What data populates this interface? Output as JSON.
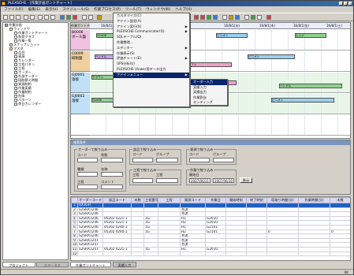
{
  "window": {
    "title": "PLEXSCHE - [作業計画ガントチャート]"
  },
  "menubar": [
    "ファイル(F)",
    "編集(E)",
    "表示(V)",
    "スケジュール(S)",
    "作業プロセス(P)",
    "ツール(T)",
    "ウィンドウ(W)",
    "ヘルプ(H)"
  ],
  "tree": {
    "items": [
      {
        "label": "作業計画",
        "icon": "computer-icon",
        "indent": 0
      },
      {
        "label": "ウィンドウ",
        "icon": "folder-icon",
        "indent": 1
      },
      {
        "label": "作業ガントチャート",
        "icon": "document-icon",
        "indent": 2
      },
      {
        "label": "負荷グラフ",
        "icon": "document-icon",
        "indent": 2
      },
      {
        "label": "作業一覧",
        "icon": "document-icon",
        "indent": 2
      },
      {
        "label": "スナップショット",
        "icon": "folder-icon",
        "indent": 1
      },
      {
        "label": "マスタ",
        "icon": "folder-icon",
        "indent": 1
      },
      {
        "label": "品目",
        "icon": "document-icon",
        "indent": 2
      },
      {
        "label": "資源",
        "icon": "document-icon",
        "indent": 2
      },
      {
        "label": "カレンダー",
        "icon": "document-icon",
        "indent": 2
      },
      {
        "label": "工程パタン",
        "icon": "document-icon",
        "indent": 2
      },
      {
        "label": "工程",
        "icon": "document-icon",
        "indent": 2
      },
      {
        "label": "オーダー",
        "icon": "document-icon",
        "indent": 2
      },
      {
        "label": "外部オーダー",
        "icon": "document-icon",
        "indent": 2
      },
      {
        "label": "段取替え時間",
        "icon": "document-icon",
        "indent": 2
      },
      {
        "label": "資源制約",
        "icon": "document-icon",
        "indent": 2
      },
      {
        "label": "作業実績",
        "icon": "document-icon",
        "indent": 2
      },
      {
        "label": "作業制約",
        "icon": "document-icon",
        "indent": 2
      },
      {
        "label": "在庫",
        "icon": "document-icon",
        "indent": 2
      },
      {
        "label": "パターン",
        "icon": "document-icon",
        "indent": 2
      },
      {
        "label": "休日カレンダー",
        "icon": "document-icon",
        "indent": 2
      }
    ],
    "tabs": [
      "プロジェクト",
      "ステータス"
    ]
  },
  "gantt": {
    "tab_label": "作業ガントチャート",
    "dates": [
      "16/8/1(月)",
      "16/8/1(月)",
      "16/8/1(水)",
      "16/8/1(木)",
      "16/8/1(金)",
      "16/8/1(土)"
    ],
    "resources": [
      {
        "code": "B0006",
        "name": "ボール盤"
      },
      {
        "code": "C0009",
        "name": "研削盤"
      },
      {
        "code": "GJ0001",
        "name": "溶接"
      },
      {
        "code": "GJ0002",
        "name": "溶接"
      },
      {
        "code": "",
        "name": ""
      }
    ],
    "bar_labels": [
      "G1006",
      "クラウン",
      "ピニオン",
      "ヒンジ",
      "ハンドル",
      "シャフト"
    ]
  },
  "context_menu": {
    "items": [
      {
        "label": "カスタマイズ(C)",
        "submenu": false,
        "selected": false
      },
      {
        "label": "アドイン設定(A)",
        "submenu": false,
        "selected": false
      },
      {
        "label": "アドイン実行(X)",
        "submenu": true,
        "selected": false
      },
      {
        "label": "PLEXSCHE Communicator(O)",
        "submenu": true,
        "selected": false
      },
      {
        "label": "SQLテーブル(Q)",
        "submenu": false,
        "selected": false
      },
      {
        "label": "作業整理...",
        "submenu": false,
        "selected": false
      },
      {
        "label": "エディター",
        "submenu": true,
        "selected": false
      },
      {
        "label": "作業表示(S)",
        "submenu": false,
        "selected": false
      },
      {
        "label": "評価チャート(E)",
        "submenu": true,
        "selected": false
      },
      {
        "label": "UPS分析(U)",
        "submenu": false,
        "selected": false
      },
      {
        "label": "PLEXSCHE Viewer用データ出力",
        "submenu": false,
        "selected": false
      },
      {
        "label": "アドインメニュー",
        "submenu": true,
        "selected": true
      }
    ],
    "submenu": [
      {
        "label": "オーダー入力",
        "selected": true
      },
      {
        "label": "実績入力",
        "selected": false
      },
      {
        "label": "実績出力",
        "selected": false
      },
      {
        "label": "作業割当",
        "selected": false
      },
      {
        "label": "セッティング",
        "selected": false
      }
    ]
  },
  "filter": {
    "title": "検索条件",
    "order_group": "オーダーで絞り込み",
    "item_group": "部品で絞り込み",
    "resource_group": "資源で絞り込み",
    "process_group": "工程で絞り込み",
    "time_group": "作業で絞り込み",
    "fields": {
      "code_label": "コード",
      "status_label": "状態",
      "kind_label": "種類",
      "name_label": "名称",
      "group_label": "グループ",
      "process_no_label": "工程",
      "comment_label": "コメント",
      "start_label": "開始日",
      "start_value": "2007/06/11",
      "end_value": "2007/06/30",
      "status_value": "",
      "kind_value": ""
    },
    "search_button": "表示"
  },
  "table": {
    "headers": [
      "",
      "オーダーコード",
      "部品コード",
      "未数",
      "工程番号",
      "工程",
      "資源コード",
      "作業日",
      "開始時刻",
      "終了時刻",
      "段取り時間(分)",
      "作業時間(分)",
      "未数"
    ],
    "rows": [
      {
        "n": "1",
        "cells": [
          "OX3GH",
          "",
          "",
          "",
          "",
          "",
          "",
          "",
          "",
          "",
          "",
          ""
        ]
      },
      {
        "n": "2",
        "cells": [
          "S2SHX1246",
          "",
          "",
          "",
          "",
          "合流",
          "",
          "",
          "",
          "",
          "",
          ""
        ]
      },
      {
        "n": "3",
        "cells": [
          "S2SHX1246",
          "",
          "",
          "",
          "",
          "合流",
          "",
          "",
          "",
          "",
          "",
          ""
        ]
      },
      {
        "n": "4",
        "cells": [
          "S2SHX1246",
          "05202 4221-1",
          "",
          "1G",
          "",
          "H1",
          "G2010",
          "",
          "",
          "",
          "",
          ""
        ]
      },
      {
        "n": "5",
        "cells": [
          "S2SHX1246",
          "05202 4221-1",
          "",
          "1G",
          "",
          "H2",
          "G2010",
          "",
          "",
          "",
          "",
          ""
        ]
      },
      {
        "n": "6",
        "cells": [
          "S2SHX1246",
          "05202 4240-1",
          "",
          "1G",
          "",
          "H1",
          "G2101",
          "",
          "",
          "",
          "",
          ""
        ]
      },
      {
        "n": "7",
        "cells": [
          "S2SHX1246",
          "05202 4240-1",
          "",
          "1G",
          "",
          "H2",
          "G2101",
          "",
          "",
          "0",
          "",
          "0"
        ]
      },
      {
        "n": "8",
        "cells": [
          "S2SHX1246",
          "",
          "",
          "",
          "",
          "合流",
          "",
          "",
          "",
          "",
          "",
          ""
        ]
      },
      {
        "n": "9",
        "cells": [
          "S2SHX1247",
          "",
          "",
          "",
          "",
          "合流",
          "",
          "",
          "",
          "",
          "",
          ""
        ]
      },
      {
        "n": "10",
        "cells": [
          "S2SHX1247",
          "",
          "",
          "",
          "",
          "合流",
          "",
          "",
          "",
          "",
          "",
          ""
        ]
      },
      {
        "n": "11",
        "cells": [
          "S2SHX1247",
          "05202 4221-1",
          "",
          "1G",
          "",
          "H1",
          "G2010",
          "",
          "",
          "",
          "",
          ""
        ]
      },
      {
        "n": "12",
        "cells": [
          "",
          "",
          "",
          "",
          "",
          "",
          "",
          "",
          "",
          "",
          "",
          ""
        ]
      }
    ]
  },
  "bottom_tabs": [
    "作業ガントチャート",
    "実績入力"
  ],
  "status": {
    "left": "",
    "right": "0K"
  }
}
